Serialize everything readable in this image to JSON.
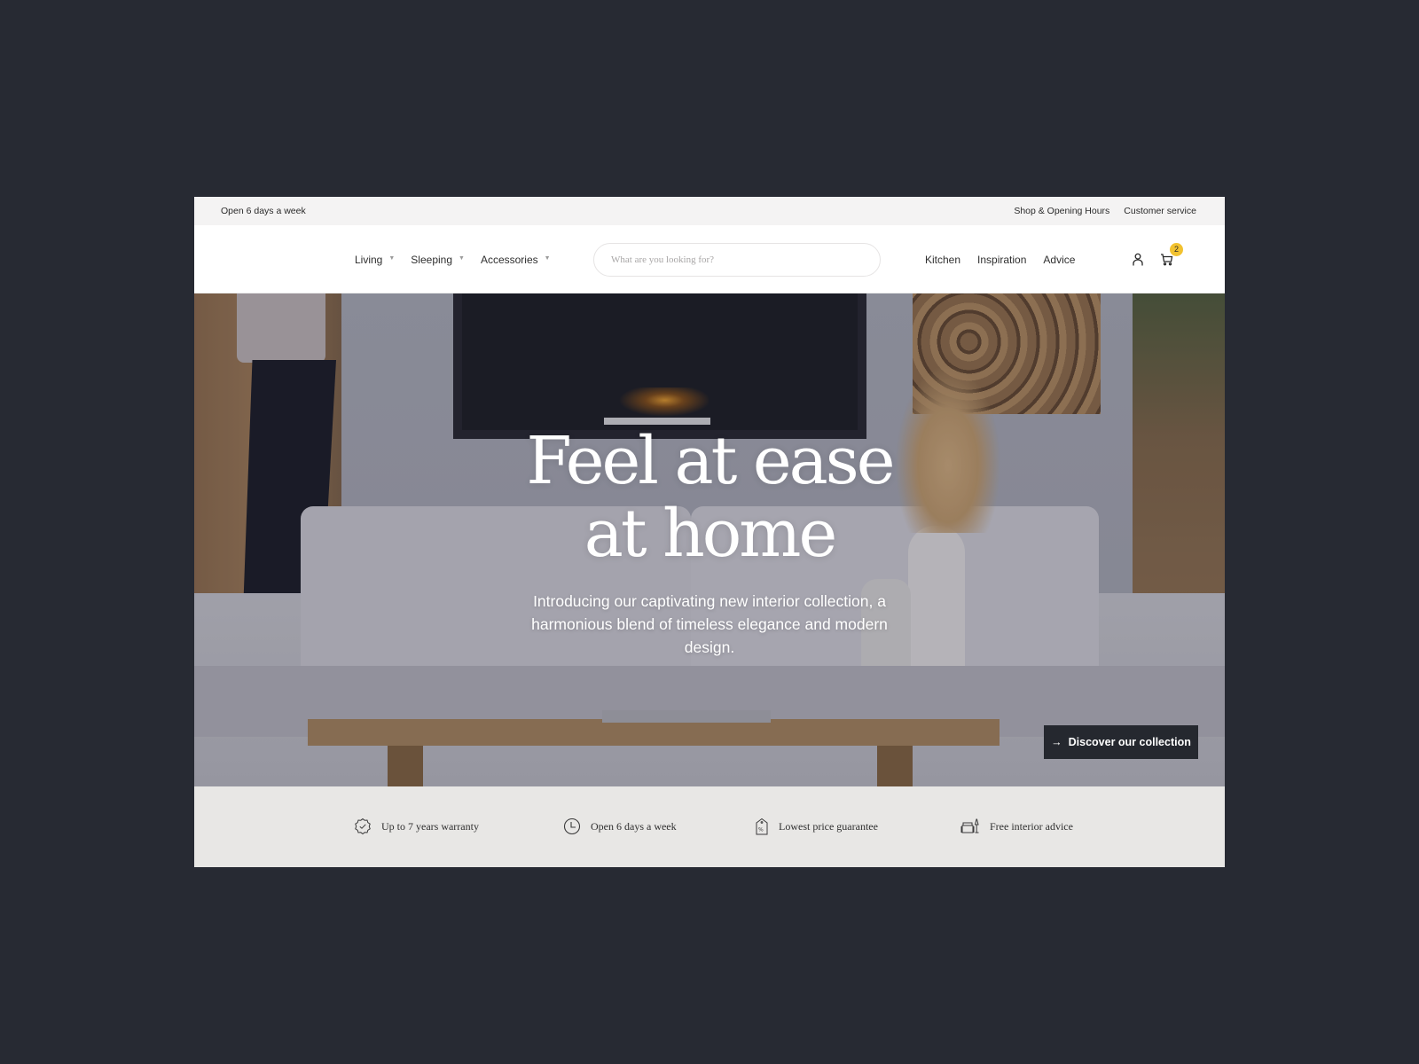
{
  "topbar": {
    "left_text": "Open 6 days a week",
    "links": [
      "Shop & Opening Hours",
      "Customer service"
    ]
  },
  "header": {
    "nav_left": [
      {
        "label": "Living",
        "has_dropdown": true
      },
      {
        "label": "Sleeping",
        "has_dropdown": true
      },
      {
        "label": "Accessories",
        "has_dropdown": true
      }
    ],
    "caret_glyph": "▼",
    "search": {
      "placeholder": "What are you looking for?",
      "value": ""
    },
    "nav_right": [
      "Kitchen",
      "Inspiration",
      "Advice"
    ],
    "account_icon": "user-icon",
    "cart_icon": "cart-icon",
    "cart_count": "2",
    "badge_color": "#f2c230"
  },
  "hero": {
    "title_line1": "Feel at ease",
    "title_line2": "at home",
    "subtitle": "Introducing our captivating new interior collection, a harmonious blend of timeless elegance and modern design.",
    "cta": {
      "arrow": "→",
      "label": "Discover our collection"
    }
  },
  "usps": [
    {
      "icon": "warranty-badge-icon",
      "label": "Up to 7 years warranty"
    },
    {
      "icon": "clock-icon",
      "label": "Open 6 days a week"
    },
    {
      "icon": "price-tag-icon",
      "label": "Lowest price guarantee"
    },
    {
      "icon": "sofa-lamp-icon",
      "label": "Free interior advice"
    }
  ],
  "colors": {
    "page_bg": "#272a33",
    "topbar_bg": "#f4f3f3",
    "usp_bg": "#e8e7e5",
    "cta_bg": "#25282f"
  }
}
